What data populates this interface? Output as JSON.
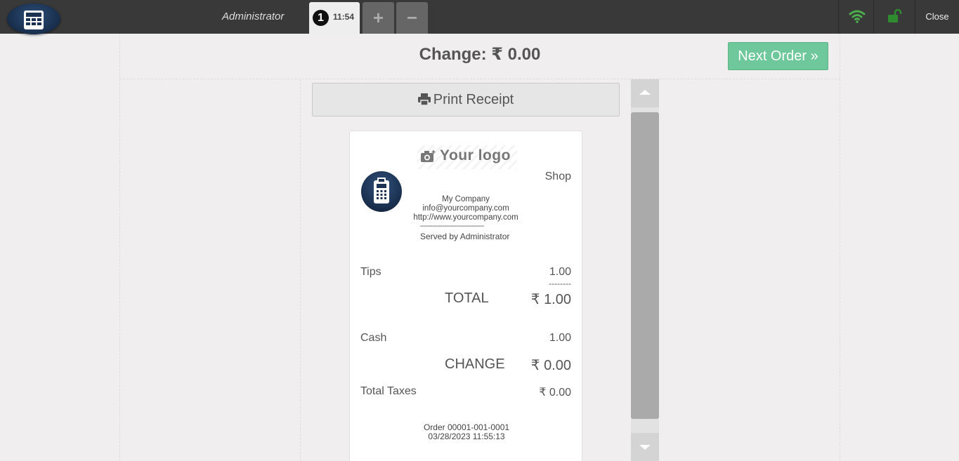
{
  "header": {
    "user": "Administrator",
    "order_number": "1",
    "order_time": "11:54",
    "add_label": "+",
    "remove_label": "−",
    "close_label": "Close",
    "wifi_color": "#4cae4c",
    "lock_color": "#2e8b2e"
  },
  "payment": {
    "change_title": "Change: ₹ 0.00",
    "next_order_label": "Next Order »",
    "print_receipt_label": "Print Receipt"
  },
  "receipt": {
    "logo_text": "Your logo",
    "shop": "Shop",
    "company_name": "My Company",
    "company_email": "info@yourcompany.com",
    "company_website": "http://www.yourcompany.com",
    "divider": "--------------------------------",
    "served_by": "Served by Administrator",
    "lines": [
      {
        "label": "Tips",
        "value": "1.00"
      }
    ],
    "sum_divider": "--------",
    "total_label": "TOTAL",
    "total_value": "₹ 1.00",
    "payment_label": "Cash",
    "payment_value": "1.00",
    "change_label": "CHANGE",
    "change_value": "₹ 0.00",
    "taxes_label": "Total Taxes",
    "taxes_value": "₹ 0.00",
    "order_ref": "Order 00001-001-0001",
    "order_datetime": "03/28/2023 11:55:13"
  }
}
